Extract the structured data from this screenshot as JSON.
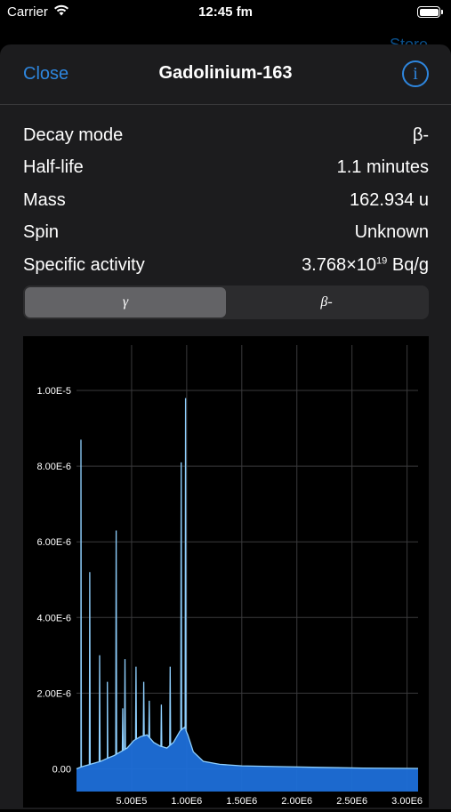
{
  "status": {
    "carrier": "Carrier",
    "time": "12:45 fm"
  },
  "background_button": "Store",
  "nav": {
    "close": "Close",
    "title": "Gadolinium-163",
    "info_icon": "info-circle-icon"
  },
  "properties": [
    {
      "label": "Decay mode",
      "value": "β-"
    },
    {
      "label": "Half-life",
      "value": "1.1 minutes"
    },
    {
      "label": "Mass",
      "value": "162.934 u"
    },
    {
      "label": "Spin",
      "value": "Unknown"
    },
    {
      "label": "Specific activity",
      "value": "3.768×10",
      "exponent": "19",
      "unit": " Bq/g"
    }
  ],
  "segments": {
    "options": [
      "γ",
      "β-"
    ],
    "selected": "γ"
  },
  "colors": {
    "accent": "#2e86de",
    "fill": "#1e6fd9",
    "line": "#8fd0ff"
  },
  "chart_data": {
    "type": "area",
    "xlim": [
      0,
      3100000
    ],
    "ylim": [
      -6e-07,
      1.12e-05
    ],
    "y_ticks": [
      0,
      2e-06,
      4e-06,
      6e-06,
      8e-06,
      1e-05
    ],
    "y_tick_labels": [
      "0.00",
      "2.00E-6",
      "4.00E-6",
      "6.00E-6",
      "8.00E-6",
      "1.00E-5"
    ],
    "x_ticks": [
      500000,
      1000000,
      1500000,
      2000000,
      2500000,
      3000000
    ],
    "x_tick_labels": [
      "5.00E5",
      "1.00E6",
      "1.50E6",
      "2.00E6",
      "2.50E6",
      "3.00E6"
    ],
    "grid": true,
    "continuum": [
      [
        0,
        0
      ],
      [
        40000,
        5e-08
      ],
      [
        100000,
        1e-07
      ],
      [
        160000,
        1.5e-07
      ],
      [
        220000,
        2e-07
      ],
      [
        280000,
        2.8e-07
      ],
      [
        340000,
        3.5e-07
      ],
      [
        400000,
        4.5e-07
      ],
      [
        460000,
        5.5e-07
      ],
      [
        520000,
        7.5e-07
      ],
      [
        580000,
        8.5e-07
      ],
      [
        640000,
        9e-07
      ],
      [
        700000,
        7e-07
      ],
      [
        760000,
        6e-07
      ],
      [
        820000,
        5.5e-07
      ],
      [
        880000,
        7e-07
      ],
      [
        940000,
        1e-06
      ],
      [
        980000,
        1.1e-06
      ],
      [
        1010000,
        9e-07
      ],
      [
        1060000,
        4.5e-07
      ],
      [
        1150000,
        2e-07
      ],
      [
        1300000,
        1.2e-07
      ],
      [
        1500000,
        8e-08
      ],
      [
        1800000,
        6e-08
      ],
      [
        2200000,
        4e-08
      ],
      [
        2600000,
        2e-08
      ],
      [
        3100000,
        1e-08
      ]
    ],
    "peaks": [
      [
        40000,
        8.7e-06
      ],
      [
        120000,
        5.2e-06
      ],
      [
        210000,
        3e-06
      ],
      [
        280000,
        2.3e-06
      ],
      [
        360000,
        6.3e-06
      ],
      [
        420000,
        1.6e-06
      ],
      [
        440000,
        2.9e-06
      ],
      [
        540000,
        2.7e-06
      ],
      [
        610000,
        2.3e-06
      ],
      [
        660000,
        1.8e-06
      ],
      [
        770000,
        1.7e-06
      ],
      [
        850000,
        2.7e-06
      ],
      [
        950000,
        8.1e-06
      ],
      [
        990000,
        9.8e-06
      ]
    ]
  }
}
